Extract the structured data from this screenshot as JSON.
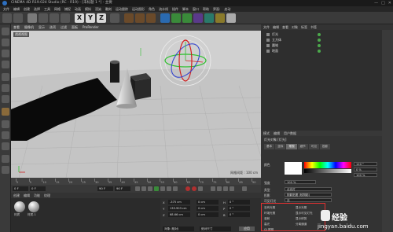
{
  "title_bar": {
    "title": "CINEMA 4D R19.024 Studio (RC - R19) - [未标题 1 *] - 主要",
    "minimize": "—",
    "maximize": "□",
    "close": "✕"
  },
  "menu_bar": {
    "items": [
      "文件",
      "编辑",
      "创建",
      "选择",
      "工具",
      "网格",
      "捕捉",
      "动画",
      "模拟",
      "渲染",
      "雕刻",
      "运动跟踪",
      "运动图形",
      "角色",
      "流水线",
      "插件",
      "脚本",
      "窗口",
      "帮助",
      "界面:",
      "启动"
    ]
  },
  "toolbar": {
    "x_label": "X",
    "y_label": "Y",
    "z_label": "Z"
  },
  "viewport": {
    "menu": [
      "查看",
      "摄像机",
      "显示",
      "选项",
      "过滤",
      "面板",
      "ProRender"
    ],
    "label": "透视视图",
    "grid_spacing": "网格间距 : 100 cm"
  },
  "object_manager": {
    "menu": [
      "文件",
      "编辑",
      "查看",
      "对象",
      "标签",
      "书签"
    ],
    "objects": [
      {
        "name": "灯光",
        "icon": "light-icon"
      },
      {
        "name": "立方体",
        "icon": "cube-icon"
      },
      {
        "name": "圆锥",
        "icon": "cone-icon"
      },
      {
        "name": "地面",
        "icon": "floor-icon"
      }
    ]
  },
  "attribute_manager": {
    "tabs_menu": [
      "模式",
      "编辑",
      "用户数据"
    ],
    "object_title": "灯光对象 [灯光]",
    "tabs": [
      "基本",
      "坐标",
      "常规",
      "细节",
      "可见",
      "投影",
      "光度",
      "焦散",
      "噪波",
      "镜头光晕",
      "工程"
    ],
    "active_tab": "常规",
    "color_label": "颜色",
    "h_value": "120 °",
    "s_value": "0 %",
    "v_value": "100 %",
    "intensity_label": "强度",
    "intensity_value": "100 %",
    "type_label": "类型",
    "type_value": "泛光灯",
    "shadow_label": "投影",
    "shadow_value": "阴影贴图 (软阴影)",
    "visible_label": "可见灯光",
    "visible_value": "无",
    "checks": [
      "没有光照",
      "环境光照",
      "漫射",
      "高光",
      "GI 照明"
    ],
    "checks_right": [
      "显示光照",
      "显示可见灯光",
      "显示修剪",
      "分离通道"
    ],
    "highlight_color": "#e23030"
  },
  "timeline": {
    "ticks": [
      "0",
      "5",
      "10",
      "15",
      "20",
      "25",
      "30",
      "35",
      "40",
      "45",
      "50",
      "55",
      "60",
      "65",
      "70",
      "75",
      "80",
      "85",
      "90"
    ]
  },
  "playback": {
    "start": "0 F",
    "current": "0 F",
    "end": "90 F",
    "end2": "90 F"
  },
  "material_manager": {
    "menu": [
      "创建",
      "编辑",
      "功能",
      "纹理"
    ],
    "materials": [
      "材质",
      "材质.1"
    ]
  },
  "coordinates": {
    "labels": [
      "X",
      "Y",
      "Z"
    ],
    "position": [
      "-375 cm",
      "135.903 cm",
      "68.66 cm"
    ],
    "size": [
      "0 cm",
      "0 cm",
      "0 cm"
    ],
    "rotation_labels": [
      "H",
      "P",
      "B"
    ],
    "rotation": [
      "0 °",
      "0 °",
      "0 °"
    ],
    "mode_left": "对象 (相对)",
    "mode_right": "绝对尺寸",
    "apply": "应用"
  },
  "watermark": {
    "brand": "经验",
    "url": "jingyan.baidu.com"
  }
}
